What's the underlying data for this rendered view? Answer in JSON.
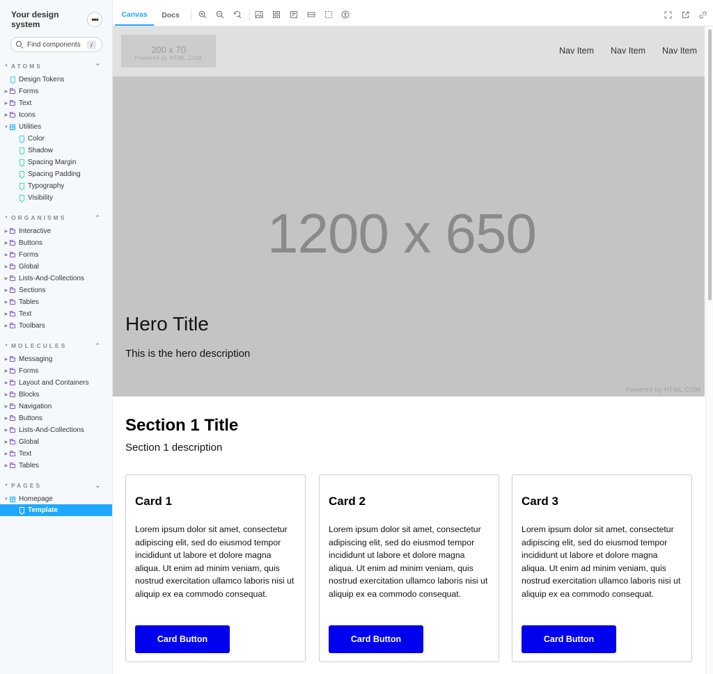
{
  "sidebar": {
    "brand": "Your design system",
    "menu_icon": "ellipsis-icon",
    "search": {
      "placeholder": "Find components",
      "shortcut": "/"
    },
    "sections": {
      "atoms": {
        "label": "ATOMS",
        "items": [
          {
            "label": "Design Tokens",
            "kind": "story"
          },
          {
            "label": "Forms",
            "kind": "folder"
          },
          {
            "label": "Text",
            "kind": "folder"
          },
          {
            "label": "Icons",
            "kind": "folder"
          },
          {
            "label": "Utilities",
            "kind": "component",
            "expanded": true
          },
          {
            "label": "Color",
            "kind": "story"
          },
          {
            "label": "Shadow",
            "kind": "story"
          },
          {
            "label": "Spacing Margin",
            "kind": "story"
          },
          {
            "label": "Spacing Padding",
            "kind": "story"
          },
          {
            "label": "Typography",
            "kind": "story"
          },
          {
            "label": "Visibility",
            "kind": "story"
          }
        ]
      },
      "organisms": {
        "label": "ORGANISMS",
        "items": [
          {
            "label": "Interactive"
          },
          {
            "label": "Buttons"
          },
          {
            "label": "Forms"
          },
          {
            "label": "Global"
          },
          {
            "label": "Lists-And-Collections"
          },
          {
            "label": "Sections"
          },
          {
            "label": "Tables"
          },
          {
            "label": "Text"
          },
          {
            "label": "Toolbars"
          }
        ]
      },
      "molecules": {
        "label": "MOLECULES",
        "items": [
          {
            "label": "Messaging"
          },
          {
            "label": "Forms"
          },
          {
            "label": "Layout and Containers"
          },
          {
            "label": "Blocks"
          },
          {
            "label": "Navigation"
          },
          {
            "label": "Buttons"
          },
          {
            "label": "Lists-And-Collections"
          },
          {
            "label": "Global"
          },
          {
            "label": "Text"
          },
          {
            "label": "Tables"
          }
        ]
      },
      "pages": {
        "label": "PAGES",
        "items": [
          {
            "label": "Homepage",
            "kind": "component",
            "expanded": true
          },
          {
            "label": "Template",
            "kind": "story",
            "selected": true
          }
        ]
      }
    }
  },
  "toolbar": {
    "tabs": [
      {
        "label": "Canvas",
        "active": true
      },
      {
        "label": "Docs",
        "active": false
      }
    ],
    "tools": [
      "zoom-in-icon",
      "zoom-out-icon",
      "zoom-reset-icon",
      "background-icon",
      "grid-icon",
      "viewport-icon",
      "measure-icon",
      "outline-icon",
      "accessibility-icon"
    ],
    "right_tools": [
      "fullscreen-icon",
      "open-new-tab-icon",
      "copy-link-icon"
    ]
  },
  "preview": {
    "logo": {
      "dimensions": "200 x 70",
      "powered": "Powered by HTML.COM"
    },
    "nav_items": [
      "Nav Item",
      "Nav Item",
      "Nav Item"
    ],
    "hero": {
      "dimensions": "1200 x 650",
      "powered": "Powered by HTML.COM",
      "title": "Hero Title",
      "description": "This is the hero description"
    },
    "section": {
      "title": "Section 1 Title",
      "description": "Section 1 description"
    },
    "cards": [
      {
        "title": "Card 1",
        "body": "Lorem ipsum dolor sit amet, consectetur adipiscing elit, sed do eiusmod tempor incididunt ut labore et dolore magna aliqua. Ut enim ad minim veniam, quis nostrud exercitation ullamco laboris nisi ut aliquip ex ea commodo consequat.",
        "button": "Card Button"
      },
      {
        "title": "Card 2",
        "body": "Lorem ipsum dolor sit amet, consectetur adipiscing elit, sed do eiusmod tempor incididunt ut labore et dolore magna aliqua. Ut enim ad minim veniam, quis nostrud exercitation ullamco laboris nisi ut aliquip ex ea commodo consequat.",
        "button": "Card Button"
      },
      {
        "title": "Card 3",
        "body": "Lorem ipsum dolor sit amet, consectetur adipiscing elit, sed do eiusmod tempor incididunt ut labore et dolore magna aliqua. Ut enim ad minim veniam, quis nostrud exercitation ullamco laboris nisi ut aliquip ex ea commodo consequat.",
        "button": "Card Button"
      }
    ]
  },
  "colors": {
    "accent": "#1ea7fd",
    "folder": "#7b4fd6",
    "story": "#37d5d3",
    "card_button": "#0000ee",
    "hero_bg": "#c4c4c4",
    "nav_bg": "#e0e0e0"
  }
}
